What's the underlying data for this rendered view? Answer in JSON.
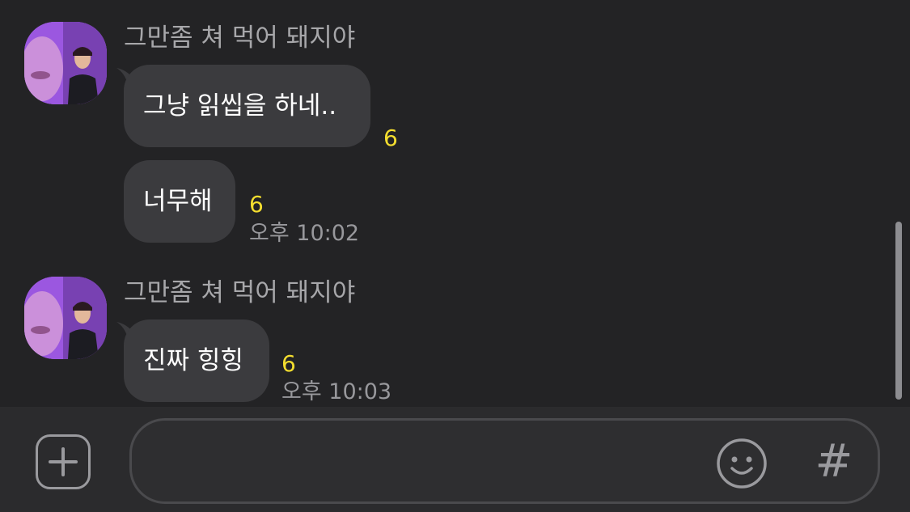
{
  "messages": [
    {
      "sender": "그만좀 쳐 먹어 돼지야",
      "avatar_icon": "profile-photo",
      "bubbles": [
        {
          "text": "그냥 읽씹을 하네..",
          "unread": "6",
          "time": ""
        },
        {
          "text": "너무해",
          "unread": "6",
          "time": "오후 10:02"
        }
      ]
    },
    {
      "sender": "그만좀 쳐 먹어 돼지야",
      "avatar_icon": "profile-photo",
      "bubbles": [
        {
          "text": "진짜 힝힝",
          "unread": "6",
          "time": "오후 10:03"
        }
      ]
    }
  ],
  "composer": {
    "placeholder": "",
    "add_icon": "plus-icon",
    "emoji_icon": "smiley-icon",
    "hash_label": "#"
  },
  "colors": {
    "background": "#232325",
    "bubble": "#3b3b3e",
    "unread": "#f4de2f",
    "time": "#98989c",
    "sender": "#a7a7aa"
  }
}
